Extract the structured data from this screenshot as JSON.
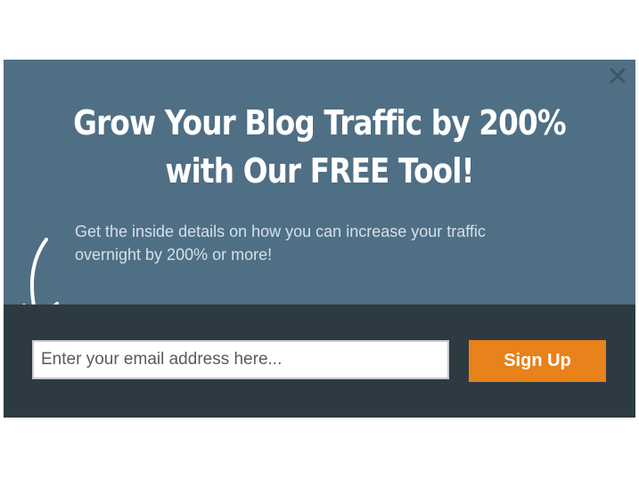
{
  "popup": {
    "title": "Grow Your Blog Traffic by 200% with Our FREE Tool!",
    "subtitle": "Get the inside details on how you can increase your traffic overnight by 200% or more!",
    "close_icon": "close-icon",
    "arrow_icon": "hand-drawn-arrow-icon"
  },
  "form": {
    "email_placeholder": "Enter your email address here...",
    "email_value": "",
    "submit_label": "Sign Up"
  },
  "colors": {
    "panel_bg": "#4f6f85",
    "band_bg": "#2e3a41",
    "button_bg": "#e8821a",
    "text_light": "#ffffff"
  }
}
